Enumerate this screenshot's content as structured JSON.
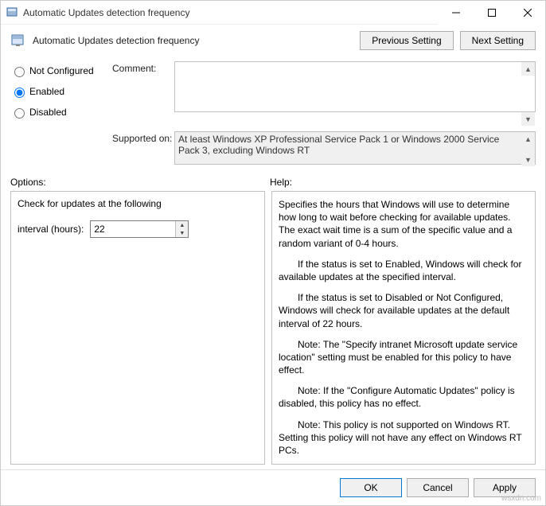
{
  "window": {
    "title": "Automatic Updates detection frequency"
  },
  "header": {
    "policy_title": "Automatic Updates detection frequency",
    "prev_btn": "Previous Setting",
    "next_btn": "Next Setting"
  },
  "radios": {
    "not_configured": "Not Configured",
    "enabled": "Enabled",
    "disabled": "Disabled",
    "selected": "enabled"
  },
  "comment": {
    "label": "Comment:",
    "value": ""
  },
  "supported": {
    "label": "Supported on:",
    "text": "At least Windows XP Professional Service Pack 1 or Windows 2000 Service Pack 3, excluding Windows RT"
  },
  "sections": {
    "options": "Options:",
    "help": "Help:"
  },
  "options": {
    "check_label": "Check for updates at the following",
    "interval_label": "interval (hours):",
    "interval_value": "22"
  },
  "help": {
    "p1": "Specifies the hours that Windows will use to determine how long to wait before checking for available updates. The exact wait time is a sum of the specific value and a random variant of 0-4 hours.",
    "p2": "If the status is set to Enabled, Windows will check for available updates at the specified interval.",
    "p3": "If the status is set to Disabled or Not Configured, Windows will check for available updates at the default interval of 22 hours.",
    "p4": "Note: The \"Specify intranet Microsoft update service location\" setting must be enabled for this policy to have effect.",
    "p5": "Note: If the \"Configure Automatic Updates\" policy is disabled, this policy has no effect.",
    "p6": "Note: This policy is not supported on Windows RT. Setting this policy will not have any effect on Windows RT PCs."
  },
  "buttons": {
    "ok": "OK",
    "cancel": "Cancel",
    "apply": "Apply"
  },
  "watermark": "wsxdn.com"
}
